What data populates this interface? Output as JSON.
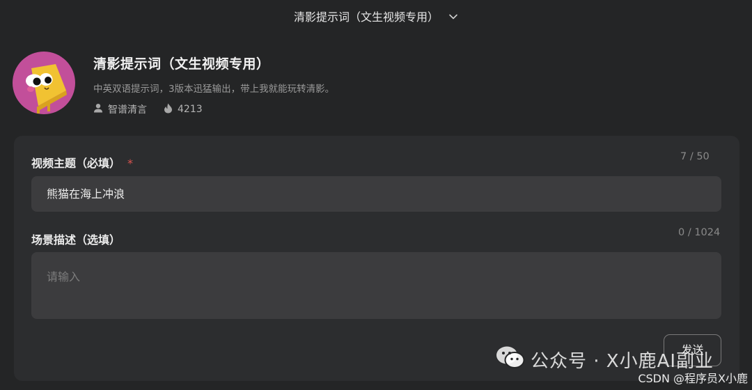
{
  "topbar": {
    "title": "清影提示词（文生视频专用）"
  },
  "agent": {
    "name": "清影提示词（文生视频专用）",
    "description": "中英双语提示词，3版本迅猛输出，带上我就能玩转清影。",
    "author": "智谱清言",
    "heat": "4213"
  },
  "form": {
    "topic": {
      "label": "视频主题（必填）",
      "required_mark": "*",
      "counter": "7 / 50",
      "value": "熊猫在海上冲浪"
    },
    "scene": {
      "label": "场景描述（选填）",
      "counter": "0 / 1024",
      "placeholder": "请输入"
    },
    "send_label": "发送"
  },
  "watermark": {
    "text": "公众号 · X小鹿AI副业",
    "credit": "CSDN @程序员X小鹿"
  },
  "colors": {
    "background": "#242526",
    "panel": "#2c2d2f",
    "input": "#3c3c3e",
    "avatar_bg": "#c24f9a",
    "required": "#d9534f"
  }
}
